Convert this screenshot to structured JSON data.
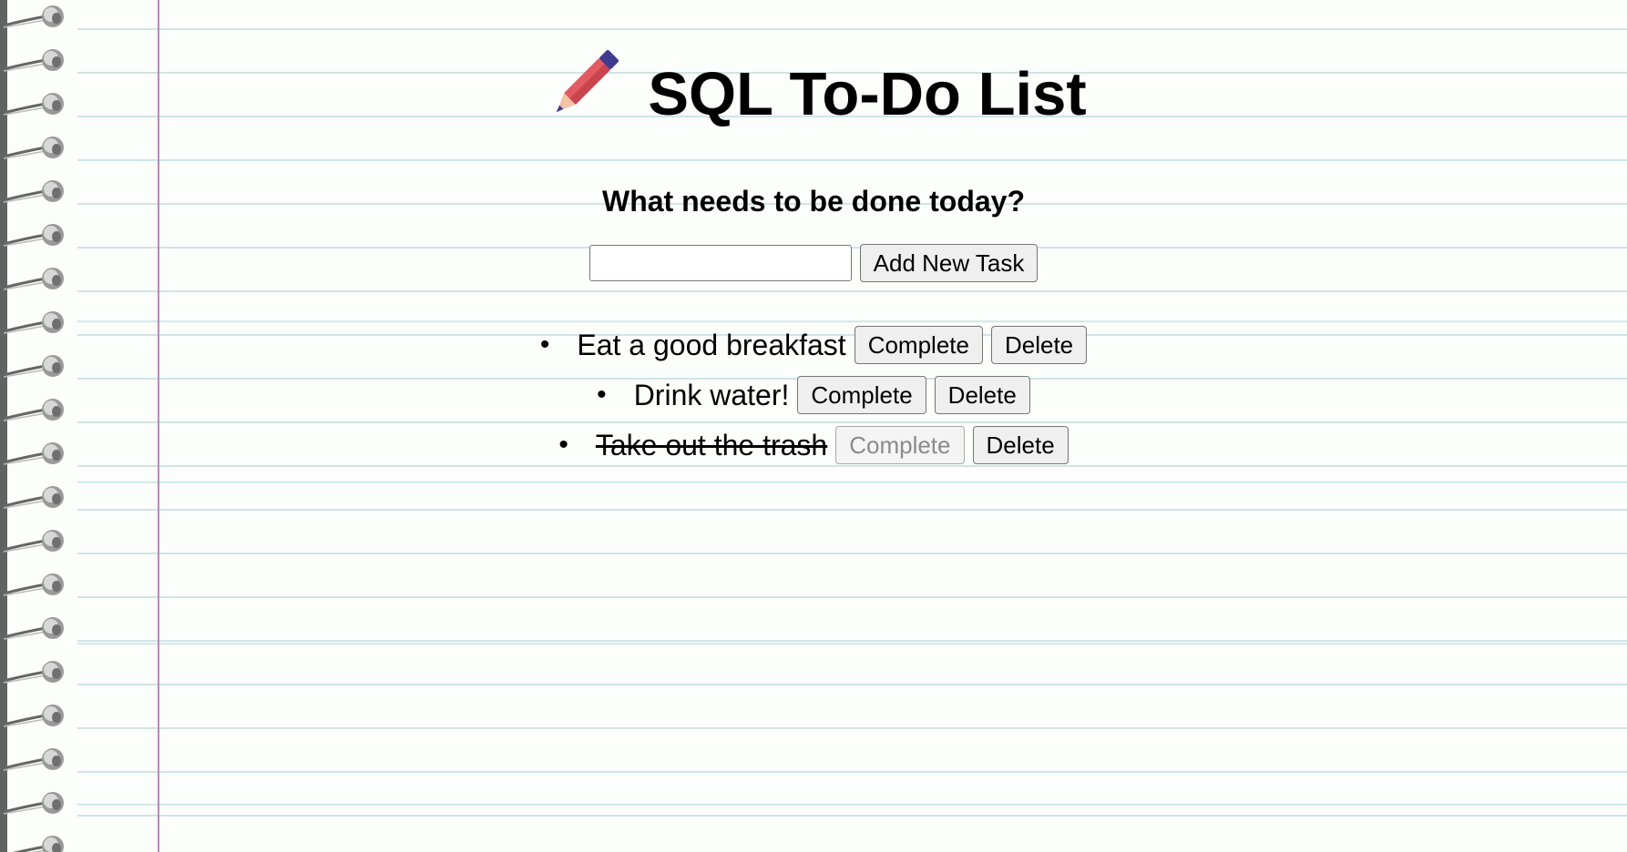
{
  "header": {
    "title": "SQL To-Do List",
    "icon": "pencil-icon"
  },
  "prompt": "What needs to be done today?",
  "add_form": {
    "input_value": "",
    "input_placeholder": "",
    "button_label": "Add New Task"
  },
  "tasks": [
    {
      "text": "Eat a good breakfast",
      "completed": false,
      "complete_label": "Complete",
      "delete_label": "Delete"
    },
    {
      "text": "Drink water!",
      "completed": false,
      "complete_label": "Complete",
      "delete_label": "Delete"
    },
    {
      "text": "Take out the trash",
      "completed": true,
      "complete_label": "Complete",
      "delete_label": "Delete"
    }
  ],
  "colors": {
    "margin_line": "#b78ab8",
    "ruled_line": "#cfe4e8",
    "paper": "#fcfefb",
    "pencil_body": "#e25b63",
    "pencil_cap": "#3f3c8f"
  }
}
